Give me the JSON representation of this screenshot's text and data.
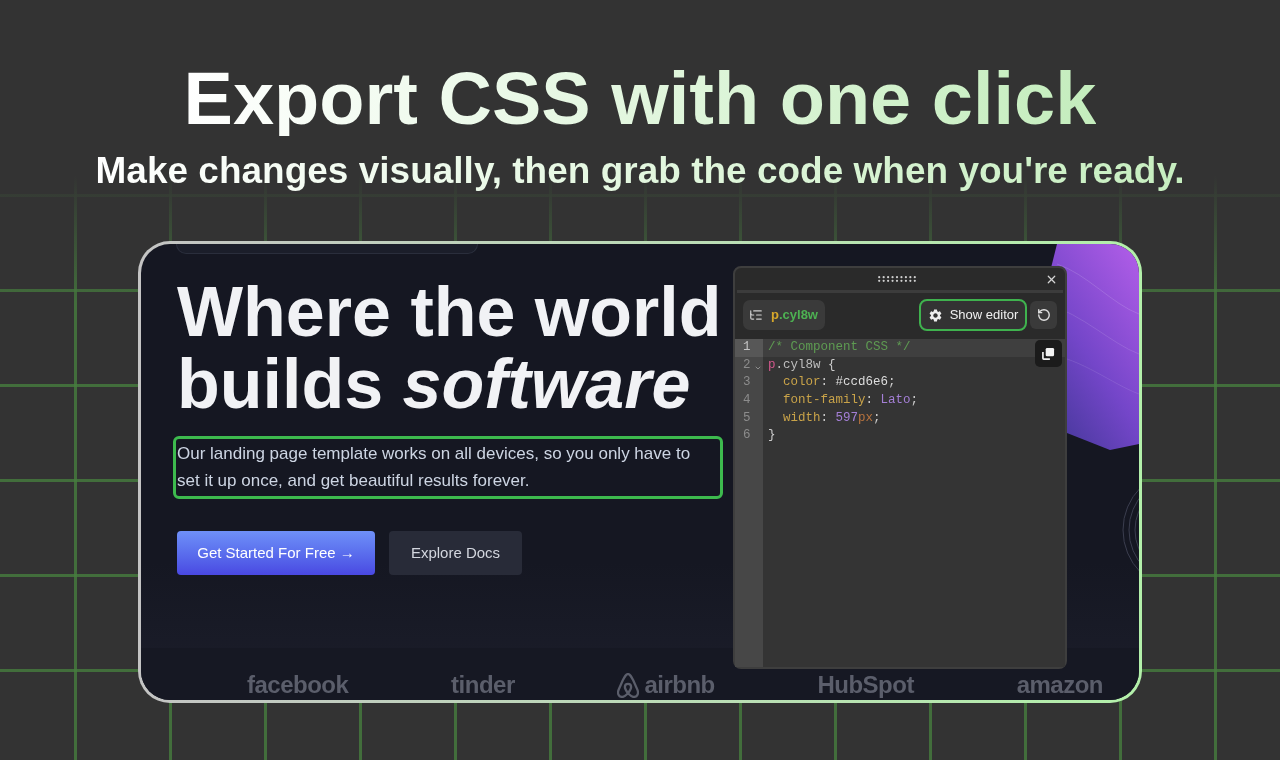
{
  "headline": {
    "title": "Export CSS with one click",
    "subtitle": "Make changes visually, then grab the code when you're ready."
  },
  "preview": {
    "heading": "Where the world builds *software*",
    "paragraph": {
      "text": "Our landing page template works on all devices, so you only have to set it up once, and get beautiful results forever.",
      "selected": true
    },
    "buttons": [
      {
        "label": "Get Started For Free →",
        "kind": "primary"
      },
      {
        "label": "Explore Docs",
        "kind": "secondary"
      }
    ],
    "logos": [
      {
        "text": "facebook",
        "kind": "wordmark"
      },
      {
        "text": "tinder",
        "kind": "wordmark"
      },
      {
        "text": "airbnb",
        "kind": "symbol_wordmark"
      },
      {
        "text": "HubSpot",
        "kind": "wordmark"
      },
      {
        "text": "amazon",
        "kind": "wordmark"
      }
    ]
  },
  "editor": {
    "selector": {
      "tag": "p",
      "class_name": ".cyl8w"
    },
    "show_editor": {
      "label": "Show editor",
      "highlighted": true
    },
    "code_lines": [
      {
        "number": "1",
        "active": true,
        "foldable": false,
        "tokens": [
          {
            "text": "/* Component CSS */",
            "kind": "comment"
          }
        ]
      },
      {
        "number": "2",
        "active": false,
        "foldable": true,
        "tokens": [
          {
            "text": "p",
            "kind": "tag"
          },
          {
            "text": ".cyl8w",
            "kind": "selector"
          },
          {
            "text": " {",
            "kind": "punct"
          }
        ]
      },
      {
        "number": "3",
        "active": false,
        "foldable": false,
        "tokens": [
          {
            "text": "  color",
            "kind": "property"
          },
          {
            "text": ": ",
            "kind": "punct"
          },
          {
            "text": "#ccd6e6",
            "kind": "value"
          },
          {
            "text": ";",
            "kind": "punct"
          }
        ]
      },
      {
        "number": "4",
        "active": false,
        "foldable": false,
        "tokens": [
          {
            "text": "  font-family",
            "kind": "property"
          },
          {
            "text": ": ",
            "kind": "punct"
          },
          {
            "text": "Lato",
            "kind": "keyword"
          },
          {
            "text": ";",
            "kind": "punct"
          }
        ]
      },
      {
        "number": "5",
        "active": false,
        "foldable": false,
        "tokens": [
          {
            "text": "  width",
            "kind": "property"
          },
          {
            "text": ": ",
            "kind": "punct"
          },
          {
            "text": "597",
            "kind": "number"
          },
          {
            "text": "px",
            "kind": "unit"
          },
          {
            "text": ";",
            "kind": "punct"
          }
        ]
      },
      {
        "number": "6",
        "active": false,
        "foldable": false,
        "tokens": [
          {
            "text": "}",
            "kind": "punct"
          }
        ]
      }
    ]
  }
}
